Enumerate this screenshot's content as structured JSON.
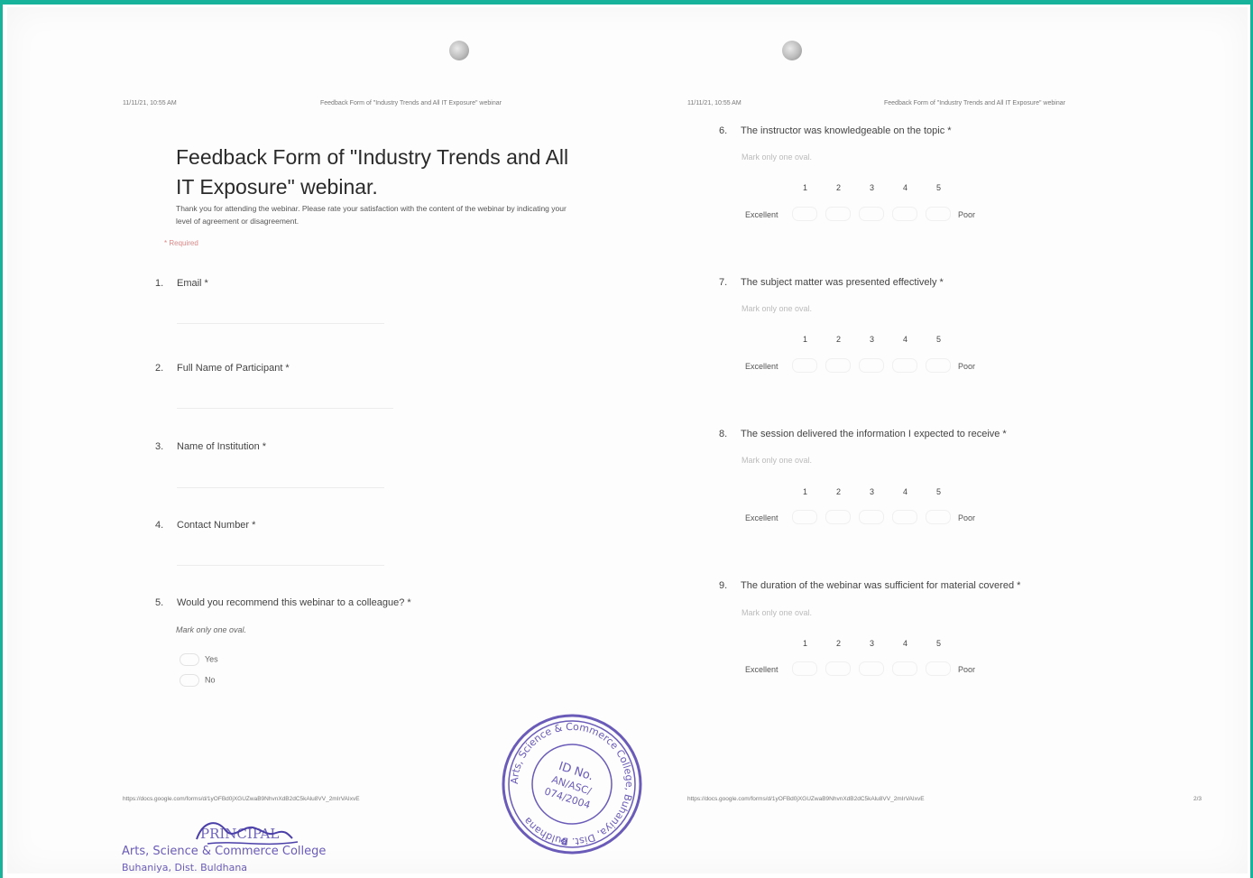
{
  "left_page": {
    "header_time": "11/11/21, 10:55 AM",
    "header_title": "Feedback Form of \"Industry Trends and All IT Exposure\" webinar",
    "form_title": "Feedback Form of \"Industry Trends and All IT Exposure\" webinar.",
    "description": "Thank you for attending the webinar. Please rate your satisfaction with the content of the webinar by indicating your level of agreement or disagreement.",
    "required_note": "* Required",
    "questions": [
      {
        "num": "1.",
        "label": "Email *"
      },
      {
        "num": "2.",
        "label": "Full Name of Participant *"
      },
      {
        "num": "3.",
        "label": "Name of Institution *"
      },
      {
        "num": "4.",
        "label": "Contact Number *"
      },
      {
        "num": "5.",
        "label": "Would you recommend this webinar to a colleague? *"
      }
    ],
    "q5_note": "Mark only one oval.",
    "q5_options": [
      "Yes",
      "No"
    ],
    "footer_url": "https://docs.google.com/forms/d/1yOFBd0jXGUZwaB9NhvnXdB2dC5kAlu8VV_2mIrVAIxvE"
  },
  "right_page": {
    "header_time": "11/11/21, 10:55 AM",
    "header_title": "Feedback Form of \"Industry Trends and All IT Exposure\" webinar",
    "questions": [
      {
        "num": "6.",
        "label": "The instructor was knowledgeable on the topic *"
      },
      {
        "num": "7.",
        "label": "The subject matter was presented effectively *"
      },
      {
        "num": "8.",
        "label": "The session delivered the information I expected to receive *"
      },
      {
        "num": "9.",
        "label": "The duration of the webinar was sufficient for material covered *"
      }
    ],
    "mark_note": "Mark only one oval.",
    "scale": [
      "1",
      "2",
      "3",
      "4",
      "5"
    ],
    "scale_left": "Excellent",
    "scale_right": "Poor",
    "footer_url": "https://docs.google.com/forms/d/1yOFBd0jXGUZwaB9NhvnXdB2dC5kAlu8VV_2mIrVAIxvE",
    "page_number": "2/3"
  },
  "stamp": {
    "ring_text": "Arts, Science & Commerce College, Buhaniya, Dist. Buldhana",
    "center_lines": [
      "ID No.",
      "AN/ASC/",
      "074/2004"
    ]
  },
  "signature": {
    "signature_text": "PRINCIPAL",
    "footer_lines": [
      "Arts, Science & Commerce College",
      "Buhaniya, Dist. Buldhana"
    ]
  },
  "colors": {
    "frame": "#17b39b",
    "stamp": "#6a5bb8",
    "ink": "#4b3fa8"
  }
}
